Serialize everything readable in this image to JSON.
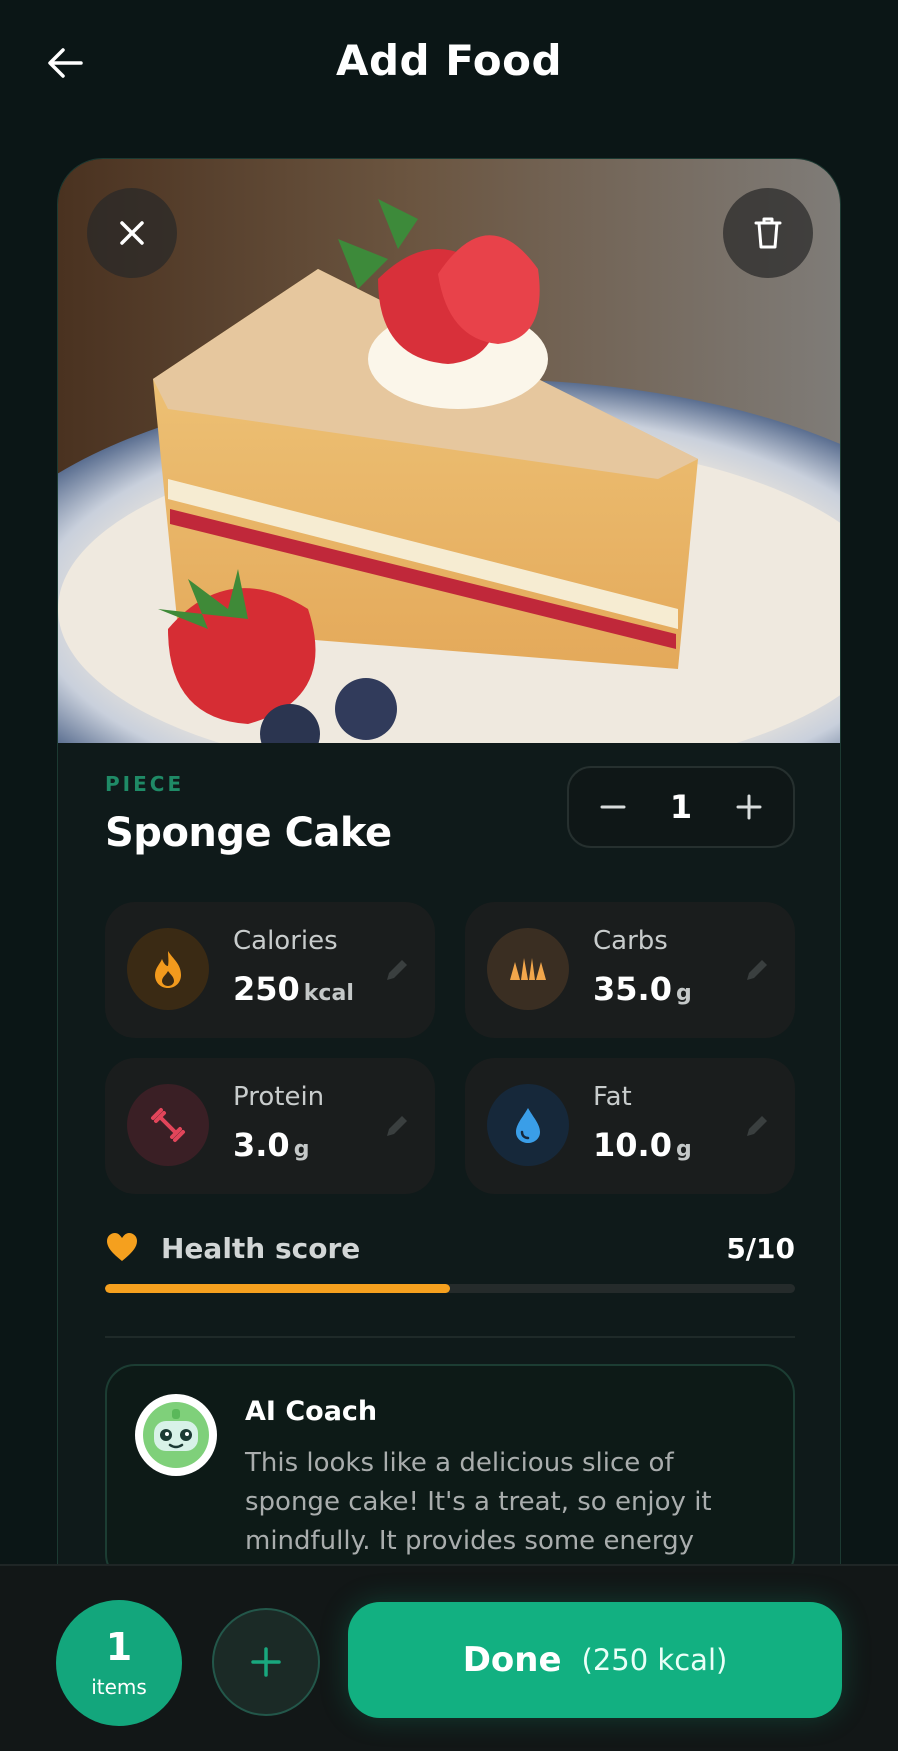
{
  "header": {
    "title": "Add Food"
  },
  "food": {
    "unit": "PIECE",
    "name": "Sponge Cake",
    "quantity": "1"
  },
  "nutrition": {
    "calories": {
      "label": "Calories",
      "value": "250",
      "unit": "kcal",
      "color": "#f29a1d"
    },
    "carbs": {
      "label": "Carbs",
      "value": "35.0",
      "unit": "g",
      "color": "#f2a64b"
    },
    "protein": {
      "label": "Protein",
      "value": "3.0",
      "unit": "g",
      "color": "#e2455a"
    },
    "fat": {
      "label": "Fat",
      "value": "10.0",
      "unit": "g",
      "color": "#3a9ee8"
    }
  },
  "health": {
    "label": "Health score",
    "value": "5/10",
    "score_fraction": 0.5,
    "color": "#f5a01e"
  },
  "coach": {
    "title": "AI Coach",
    "text": "This looks like a delicious slice of sponge cake! It's a treat, so enjoy it mindfully. It provides some energy"
  },
  "footer": {
    "items_count": "1",
    "items_label": "items",
    "done_label": "Done",
    "done_kcal": "(250 kcal)"
  },
  "icons": {
    "back": "arrow-left-icon",
    "close": "close-icon",
    "delete": "trash-icon",
    "minus": "minus-icon",
    "plus": "plus-icon",
    "calories": "flame-icon",
    "carbs": "bread-icon",
    "protein": "dumbbell-icon",
    "fat": "drop-icon",
    "edit": "pencil-icon",
    "health": "heart-icon",
    "coach": "robot-avatar-icon",
    "add": "plus-icon"
  },
  "colors": {
    "accent": "#12b081",
    "background": "#0b1616"
  }
}
